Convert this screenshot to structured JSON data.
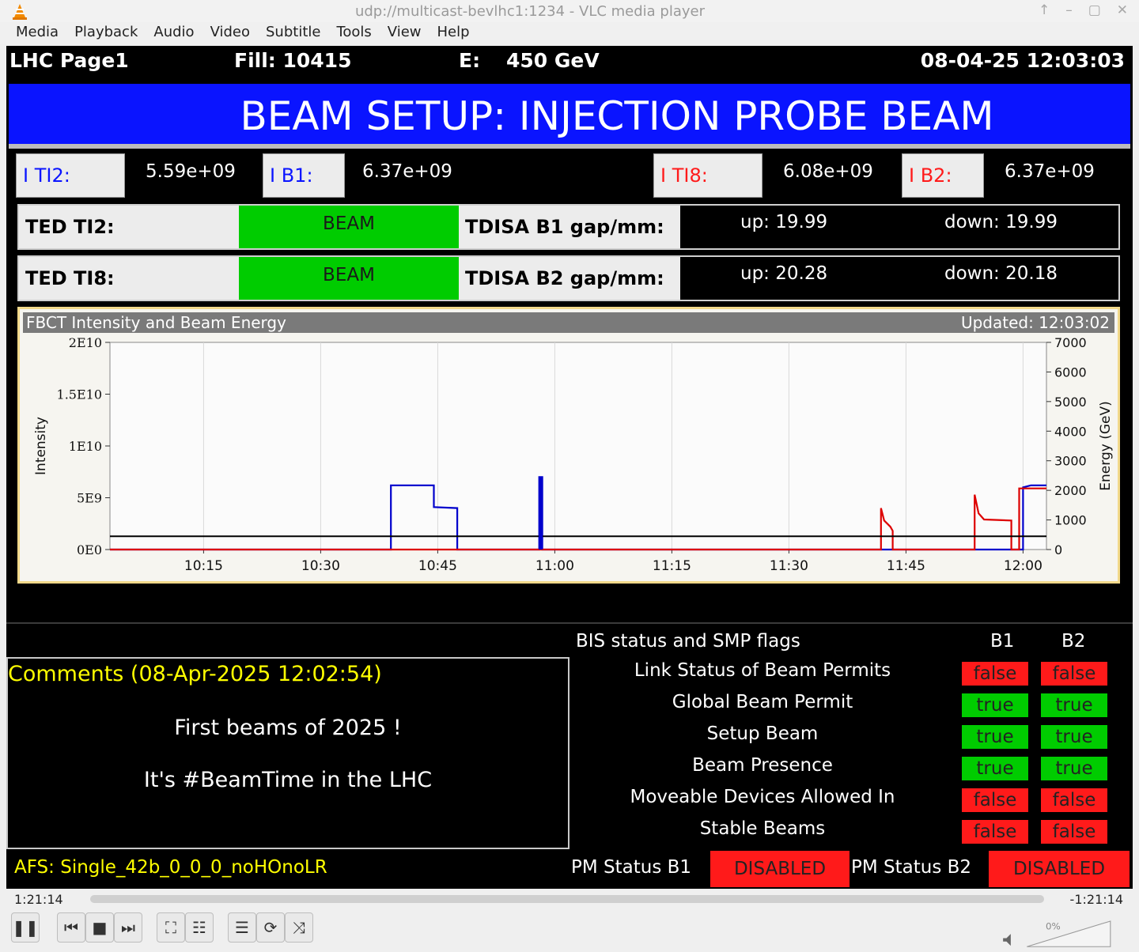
{
  "window": {
    "title": "udp://multicast-bevlhc1:1234 - VLC media player"
  },
  "menu": [
    "Media",
    "Playback",
    "Audio",
    "Video",
    "Subtitle",
    "Tools",
    "View",
    "Help"
  ],
  "header": {
    "page": "LHC Page1",
    "fill": "Fill: 10415",
    "energy_label": "E:",
    "energy_value": "450 GeV",
    "datetime": "08-04-25 12:03:03"
  },
  "banner": "BEAM SETUP: INJECTION PROBE BEAM",
  "intensities": {
    "ti2_label": "I TI2:",
    "ti2_value": "5.59e+09",
    "b1_label": "I B1:",
    "b1_value": "6.37e+09",
    "ti8_label": "I TI8:",
    "ti8_value": "6.08e+09",
    "b2_label": "I B2:",
    "b2_value": "6.37e+09"
  },
  "ted": [
    {
      "name": "TED TI2:",
      "status": "BEAM",
      "gap_label": "TDISA B1 gap/mm:",
      "up": "up:  19.99",
      "down": "down:  19.99"
    },
    {
      "name": "TED TI8:",
      "status": "BEAM",
      "gap_label": "TDISA B2 gap/mm:",
      "up": "up:  20.28",
      "down": "down:  20.18"
    }
  ],
  "chart_title": "FBCT Intensity and Beam Energy",
  "chart_updated": "Updated: 12:03:02",
  "chart_data": {
    "type": "line",
    "xlabel": "",
    "ylabel": "Intensity",
    "y2label": "Energy (GeV)",
    "x_ticks": [
      "10:15",
      "10:30",
      "10:45",
      "11:00",
      "11:15",
      "11:30",
      "11:45",
      "12:00"
    ],
    "y_ticks": [
      "0E0",
      "5E9",
      "1E10",
      "1.5E10",
      "2E10"
    ],
    "y2_ticks": [
      "0",
      "1000",
      "2000",
      "3000",
      "4000",
      "5000",
      "6000",
      "7000"
    ],
    "ylim": [
      0,
      20000000000
    ],
    "y2lim": [
      0,
      7000
    ],
    "x_range_minutes": [
      603,
      723
    ],
    "series": [
      {
        "color": "#0000cc",
        "points": [
          [
            603,
            0
          ],
          [
            639,
            0
          ],
          [
            639,
            6200000000.0
          ],
          [
            644.5,
            6200000000.0
          ],
          [
            644.5,
            4100000000.0
          ],
          [
            647.5,
            4000000000.0
          ],
          [
            647.5,
            0
          ],
          [
            658,
            0
          ],
          [
            658,
            7000000000.0
          ],
          [
            658.4,
            7000000000.0
          ],
          [
            658.4,
            0
          ],
          [
            713,
            0
          ],
          [
            718,
            0
          ],
          [
            718.5,
            0
          ],
          [
            718.5,
            0
          ],
          [
            720,
            0
          ],
          [
            720,
            6000000000.0
          ],
          [
            721,
            6200000000.0
          ],
          [
            723,
            6200000000.0
          ]
        ]
      },
      {
        "color": "#dd0000",
        "points": [
          [
            603,
            0
          ],
          [
            701.8,
            0
          ],
          [
            701.8,
            4000000000.0
          ],
          [
            702.2,
            2800000000.0
          ],
          [
            703,
            2200000000.0
          ],
          [
            703.3,
            1800000000.0
          ],
          [
            703.3,
            0
          ],
          [
            713.8,
            0
          ],
          [
            713.8,
            5300000000.0
          ],
          [
            714.3,
            3500000000.0
          ],
          [
            715,
            2900000000.0
          ],
          [
            718.5,
            2800000000.0
          ],
          [
            718.5,
            0
          ],
          [
            719.5,
            0
          ],
          [
            719.5,
            5900000000.0
          ],
          [
            723,
            5900000000.0
          ]
        ]
      },
      {
        "color": "#000000",
        "axis": "y2",
        "points": [
          [
            603,
            450
          ],
          [
            723,
            450
          ]
        ]
      }
    ]
  },
  "comments": {
    "title": "Comments (08-Apr-2025 12:02:54)",
    "line1": "First beams of 2025 !",
    "line2": "It's #BeamTime in the LHC"
  },
  "bis": {
    "title": "BIS status and SMP flags",
    "col_b1": "B1",
    "col_b2": "B2",
    "flags": [
      {
        "label": "Link Status of Beam Permits",
        "b1": "false",
        "b2": "false"
      },
      {
        "label": "Global Beam Permit",
        "b1": "true",
        "b2": "true"
      },
      {
        "label": "Setup Beam",
        "b1": "true",
        "b2": "true"
      },
      {
        "label": "Beam Presence",
        "b1": "true",
        "b2": "true"
      },
      {
        "label": "Moveable Devices Allowed In",
        "b1": "false",
        "b2": "false"
      },
      {
        "label": "Stable Beams",
        "b1": "false",
        "b2": "false"
      }
    ]
  },
  "afs": "AFS: Single_42b_0_0_0_noHOnoLR",
  "pm": {
    "b1_label": "PM Status B1",
    "b1_value": "DISABLED",
    "b2_label": "PM Status B2",
    "b2_value": "DISABLED"
  },
  "player": {
    "elapsed": "1:21:14",
    "remaining": "-1:21:14",
    "volume": "0%"
  }
}
